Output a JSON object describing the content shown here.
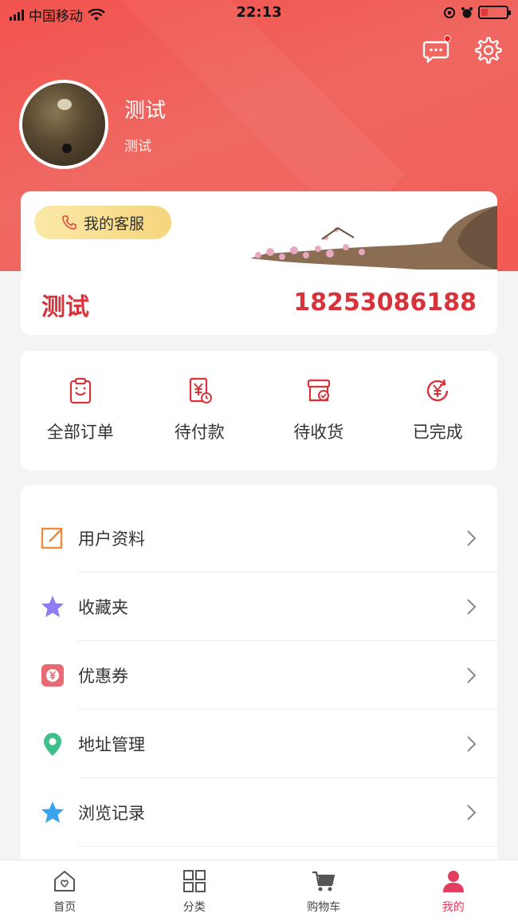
{
  "status_bar": {
    "carrier": "中国移动",
    "time": "22:13"
  },
  "profile": {
    "name": "测试",
    "subtitle": "测试"
  },
  "info_card": {
    "service_label": "我的客服",
    "name": "测试",
    "phone": "18253086188"
  },
  "orders": [
    {
      "label": "全部订单",
      "icon": "clipboard-icon"
    },
    {
      "label": "待付款",
      "icon": "yen-bill-icon"
    },
    {
      "label": "待收货",
      "icon": "box-check-icon"
    },
    {
      "label": "已完成",
      "icon": "yen-refresh-icon"
    }
  ],
  "menu": [
    {
      "label": "用户资料",
      "icon": "edit-icon",
      "color": "#f08a3c"
    },
    {
      "label": "收藏夹",
      "icon": "star-icon",
      "color": "#8f7cf0"
    },
    {
      "label": "优惠券",
      "icon": "coupon-icon",
      "color": "#e86a72"
    },
    {
      "label": "地址管理",
      "icon": "location-pin-icon",
      "color": "#3fc08a"
    },
    {
      "label": "浏览记录",
      "icon": "star-icon",
      "color": "#3aa3ee"
    }
  ],
  "tabbar": [
    {
      "label": "首页",
      "icon": "home-icon",
      "active": false
    },
    {
      "label": "分类",
      "icon": "grid-icon",
      "active": false
    },
    {
      "label": "购物车",
      "icon": "cart-icon",
      "active": false
    },
    {
      "label": "我的",
      "icon": "user-icon",
      "active": true
    }
  ],
  "colors": {
    "brand_red": "#f24a45",
    "accent_text": "#d8333a",
    "active_tab": "#e23c5e",
    "order_icon": "#d8333a"
  }
}
